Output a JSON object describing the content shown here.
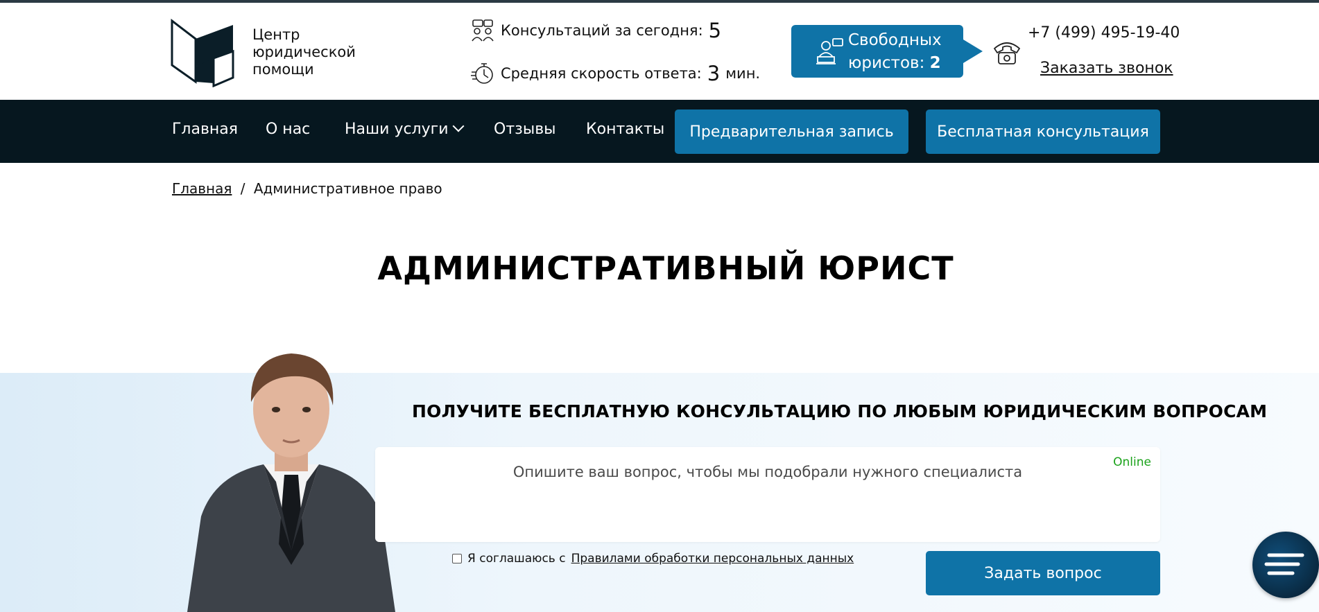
{
  "header": {
    "logo_text": "Центр юридической помощи",
    "consultations_label": "Консультаций за сегодня:",
    "consultations_value": "5",
    "speed_label": "Средняя скорость ответа:",
    "speed_value": "3",
    "speed_unit": "мин.",
    "free_lawyers_label_1": "Свободных",
    "free_lawyers_label_2": "юристов:",
    "free_lawyers_value": "2",
    "phone": "+7 (499) 495-19-40",
    "callback": "Заказать звонок"
  },
  "nav": {
    "items": [
      {
        "label": "Главная"
      },
      {
        "label": "О нас"
      },
      {
        "label": "Наши услуги"
      },
      {
        "label": "Отзывы"
      },
      {
        "label": "Контакты"
      }
    ],
    "prebook": "Предварительная запись",
    "free_consult": "Бесплатная консультация"
  },
  "breadcrumb": {
    "home": "Главная",
    "separator": "/",
    "current": "Административное право"
  },
  "page_title": "АДМИНИСТРАТИВНЫЙ ЮРИСТ",
  "consult": {
    "title": "ПОЛУЧИТЕ БЕСПЛАТНУЮ КОНСУЛЬТАЦИЮ ПО ЛЮБЫМ ЮРИДИЧЕСКИМ ВОПРОСАМ",
    "placeholder": "Опишите ваш вопрос, чтобы мы подобрали нужного специалиста",
    "status": "Online",
    "agree_prefix": "Я соглашаюсь с",
    "agree_link": "Правилами обработки персональных данных",
    "submit": "Задать вопрос"
  },
  "colors": {
    "brand_blue": "#0f73a7",
    "nav_bg": "#06171f",
    "online_green": "#1aa21a"
  },
  "icons": [
    "logo-icon",
    "chat-people-icon",
    "stopwatch-icon",
    "lawyer-laptop-icon",
    "phone-icon",
    "chevron-down-icon",
    "menu-icon"
  ]
}
